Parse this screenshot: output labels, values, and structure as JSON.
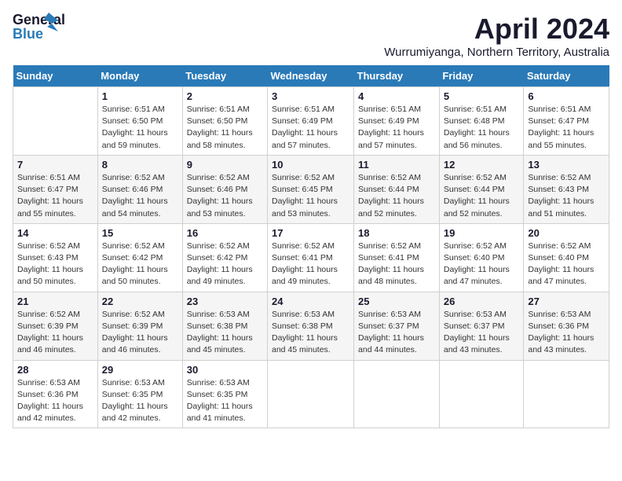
{
  "logo": {
    "line1": "General",
    "line2": "Blue"
  },
  "title": "April 2024",
  "subtitle": "Wurrumiyanga, Northern Territory, Australia",
  "headers": [
    "Sunday",
    "Monday",
    "Tuesday",
    "Wednesday",
    "Thursday",
    "Friday",
    "Saturday"
  ],
  "weeks": [
    [
      {
        "day": "",
        "info": ""
      },
      {
        "day": "1",
        "info": "Sunrise: 6:51 AM\nSunset: 6:50 PM\nDaylight: 11 hours\nand 59 minutes."
      },
      {
        "day": "2",
        "info": "Sunrise: 6:51 AM\nSunset: 6:50 PM\nDaylight: 11 hours\nand 58 minutes."
      },
      {
        "day": "3",
        "info": "Sunrise: 6:51 AM\nSunset: 6:49 PM\nDaylight: 11 hours\nand 57 minutes."
      },
      {
        "day": "4",
        "info": "Sunrise: 6:51 AM\nSunset: 6:49 PM\nDaylight: 11 hours\nand 57 minutes."
      },
      {
        "day": "5",
        "info": "Sunrise: 6:51 AM\nSunset: 6:48 PM\nDaylight: 11 hours\nand 56 minutes."
      },
      {
        "day": "6",
        "info": "Sunrise: 6:51 AM\nSunset: 6:47 PM\nDaylight: 11 hours\nand 55 minutes."
      }
    ],
    [
      {
        "day": "7",
        "info": "Sunrise: 6:51 AM\nSunset: 6:47 PM\nDaylight: 11 hours\nand 55 minutes."
      },
      {
        "day": "8",
        "info": "Sunrise: 6:52 AM\nSunset: 6:46 PM\nDaylight: 11 hours\nand 54 minutes."
      },
      {
        "day": "9",
        "info": "Sunrise: 6:52 AM\nSunset: 6:46 PM\nDaylight: 11 hours\nand 53 minutes."
      },
      {
        "day": "10",
        "info": "Sunrise: 6:52 AM\nSunset: 6:45 PM\nDaylight: 11 hours\nand 53 minutes."
      },
      {
        "day": "11",
        "info": "Sunrise: 6:52 AM\nSunset: 6:44 PM\nDaylight: 11 hours\nand 52 minutes."
      },
      {
        "day": "12",
        "info": "Sunrise: 6:52 AM\nSunset: 6:44 PM\nDaylight: 11 hours\nand 52 minutes."
      },
      {
        "day": "13",
        "info": "Sunrise: 6:52 AM\nSunset: 6:43 PM\nDaylight: 11 hours\nand 51 minutes."
      }
    ],
    [
      {
        "day": "14",
        "info": "Sunrise: 6:52 AM\nSunset: 6:43 PM\nDaylight: 11 hours\nand 50 minutes."
      },
      {
        "day": "15",
        "info": "Sunrise: 6:52 AM\nSunset: 6:42 PM\nDaylight: 11 hours\nand 50 minutes."
      },
      {
        "day": "16",
        "info": "Sunrise: 6:52 AM\nSunset: 6:42 PM\nDaylight: 11 hours\nand 49 minutes."
      },
      {
        "day": "17",
        "info": "Sunrise: 6:52 AM\nSunset: 6:41 PM\nDaylight: 11 hours\nand 49 minutes."
      },
      {
        "day": "18",
        "info": "Sunrise: 6:52 AM\nSunset: 6:41 PM\nDaylight: 11 hours\nand 48 minutes."
      },
      {
        "day": "19",
        "info": "Sunrise: 6:52 AM\nSunset: 6:40 PM\nDaylight: 11 hours\nand 47 minutes."
      },
      {
        "day": "20",
        "info": "Sunrise: 6:52 AM\nSunset: 6:40 PM\nDaylight: 11 hours\nand 47 minutes."
      }
    ],
    [
      {
        "day": "21",
        "info": "Sunrise: 6:52 AM\nSunset: 6:39 PM\nDaylight: 11 hours\nand 46 minutes."
      },
      {
        "day": "22",
        "info": "Sunrise: 6:52 AM\nSunset: 6:39 PM\nDaylight: 11 hours\nand 46 minutes."
      },
      {
        "day": "23",
        "info": "Sunrise: 6:53 AM\nSunset: 6:38 PM\nDaylight: 11 hours\nand 45 minutes."
      },
      {
        "day": "24",
        "info": "Sunrise: 6:53 AM\nSunset: 6:38 PM\nDaylight: 11 hours\nand 45 minutes."
      },
      {
        "day": "25",
        "info": "Sunrise: 6:53 AM\nSunset: 6:37 PM\nDaylight: 11 hours\nand 44 minutes."
      },
      {
        "day": "26",
        "info": "Sunrise: 6:53 AM\nSunset: 6:37 PM\nDaylight: 11 hours\nand 43 minutes."
      },
      {
        "day": "27",
        "info": "Sunrise: 6:53 AM\nSunset: 6:36 PM\nDaylight: 11 hours\nand 43 minutes."
      }
    ],
    [
      {
        "day": "28",
        "info": "Sunrise: 6:53 AM\nSunset: 6:36 PM\nDaylight: 11 hours\nand 42 minutes."
      },
      {
        "day": "29",
        "info": "Sunrise: 6:53 AM\nSunset: 6:35 PM\nDaylight: 11 hours\nand 42 minutes."
      },
      {
        "day": "30",
        "info": "Sunrise: 6:53 AM\nSunset: 6:35 PM\nDaylight: 11 hours\nand 41 minutes."
      },
      {
        "day": "",
        "info": ""
      },
      {
        "day": "",
        "info": ""
      },
      {
        "day": "",
        "info": ""
      },
      {
        "day": "",
        "info": ""
      }
    ]
  ]
}
